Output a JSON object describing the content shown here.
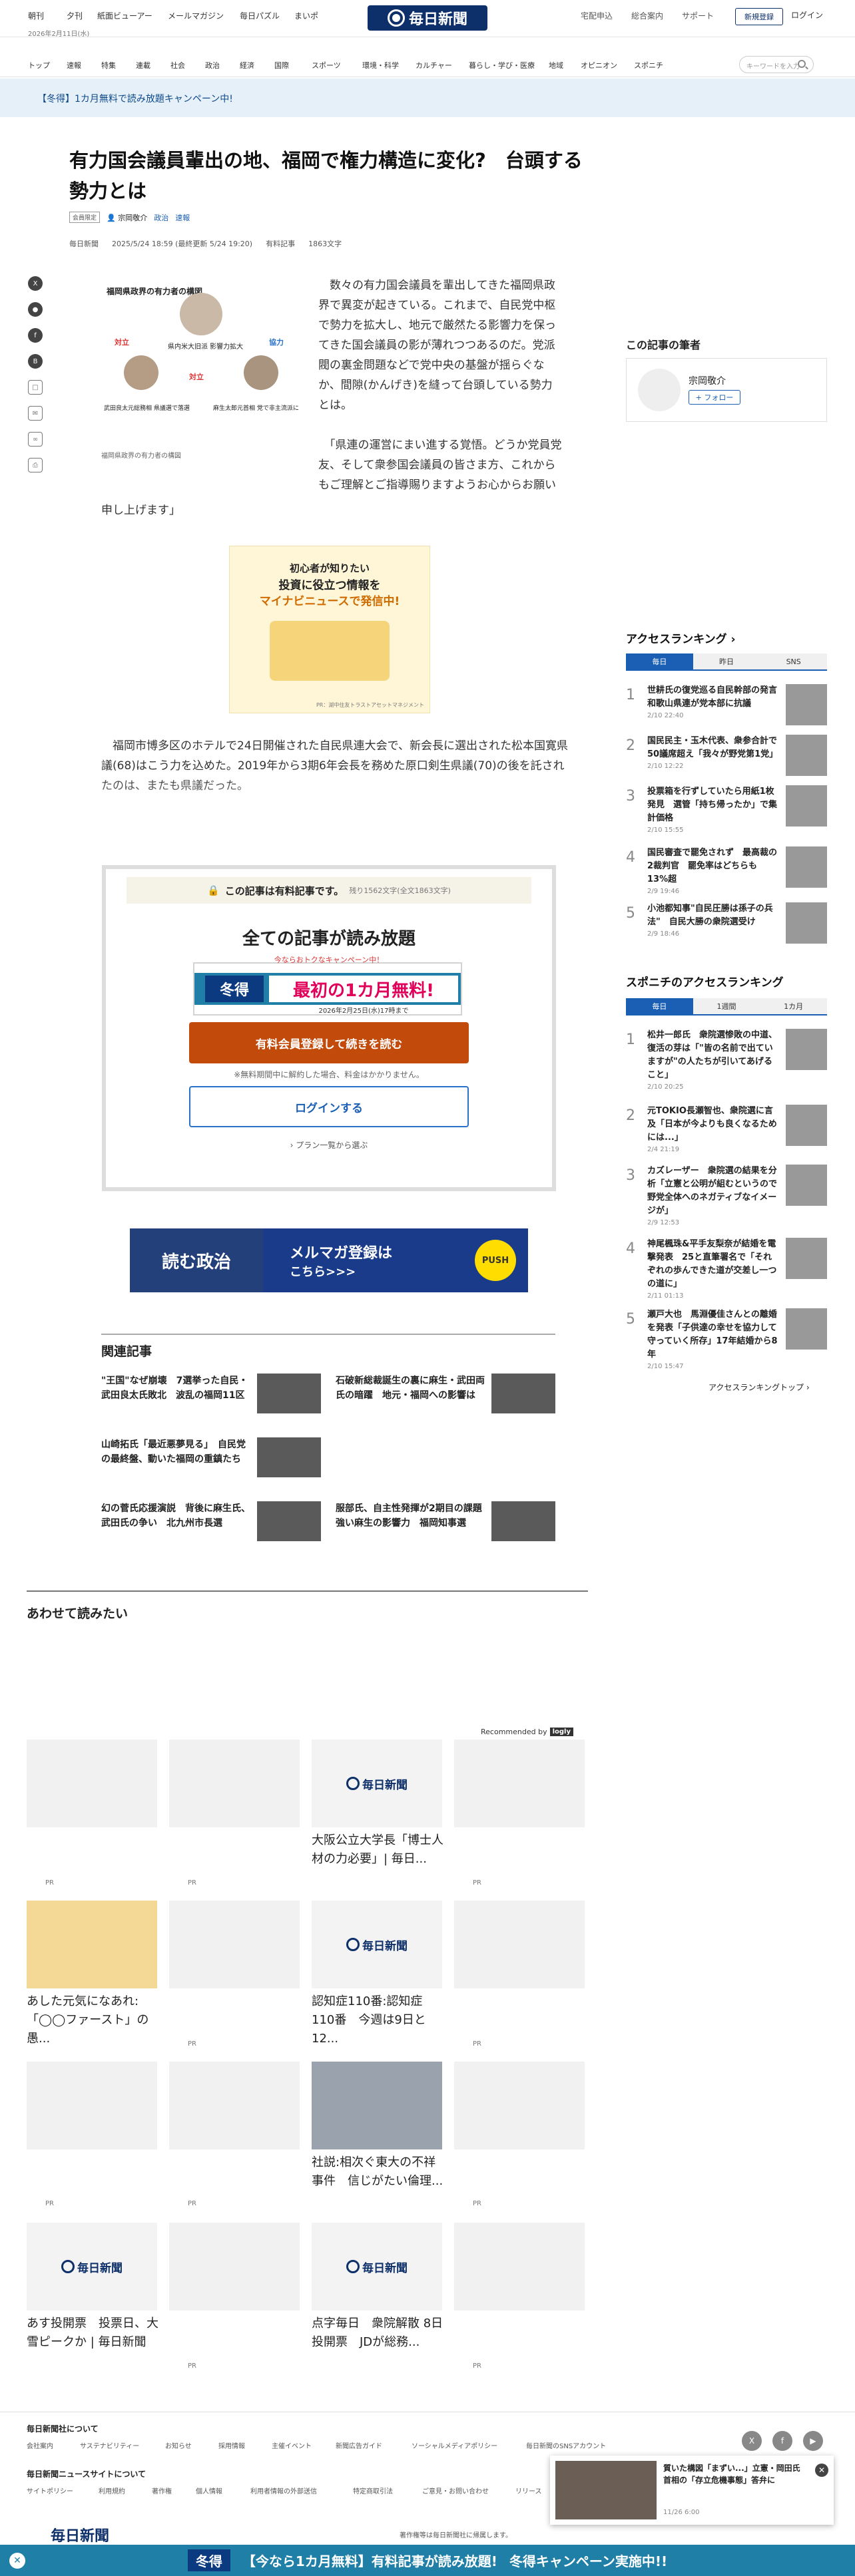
{
  "header": {
    "top_links": [
      "朝刊",
      "夕刊",
      "紙面ビューアー",
      "メールマガジン",
      "毎日パズル",
      "まいポ"
    ],
    "date": "2026年2月11日(水)",
    "logo": "毎日新聞",
    "right_links": [
      "宅配申込",
      "総合案内",
      "サポート"
    ],
    "register": "新規登録",
    "login": "ログイン"
  },
  "nav": {
    "items": [
      "トップ",
      "速報",
      "特集",
      "連載",
      "社会",
      "政治",
      "経済",
      "国際",
      "スポーツ",
      "環境・科学",
      "カルチャー",
      "暮らし・学び・医療",
      "地域",
      "オピニオン",
      "スポニチ"
    ],
    "search_placeholder": "キーワードを入力"
  },
  "campaign": {
    "text": "【冬得】1カ月無料で読み放題キャンペーン中!"
  },
  "article": {
    "title": "有力国会議員輩出の地、福岡で権力構造に変化?　台頭する勢力とは",
    "tag_badge": "会員限定",
    "author": "宗岡敬介",
    "cats": [
      "政治",
      "速報"
    ],
    "meta": [
      "毎日新聞",
      "2025/5/24 18:59 (最終更新 5/24 19:20)",
      "有料記事",
      "1863文字"
    ],
    "photo_caption": "福岡県政界の有力者の構図",
    "photo_labels": {
      "title": "福岡県政界の有力者の構図",
      "opp": "対立",
      "coop": "協力",
      "center": "県内米大旧派 影響力拡大",
      "opp2": "対立",
      "left": "武田良太元総務相 県議選で落選",
      "right": "麻生太郎元首相 党で非主流派に"
    },
    "p1": "　数々の有力国会議員を輩出してきた福岡県政界で異変が起きている。これまで、自民党中枢で勢力を拡大し、地元で厳然たる影響力を保ってきた国会議員の影が薄れつつあるのだ。党派閥の裏金問題などで党中央の基盤が揺らぐなか、間隙(かんげき)を縫って台頭している勢力とは。",
    "p2": "　「県連の運営にまい進する覚悟。どうか党員党友、そして衆参国会議員の皆さま方、これからもご理解とご指導賜りますようお心からお願い",
    "p3": "申し上げます」",
    "ad1": {
      "line1": "初心者が知りたい",
      "line2": "投資に役立つ情報を",
      "line3": "マイナビニュースで発信中!",
      "small": "PR：湖中住友トラストアセットマネジメント"
    },
    "p4": "　福岡市博多区のホテルで24日開催された自民県連大会で、新会長に選出された松本国寛県議(68)はこう力を込めた。2019年から3期6年会長を務めた原口剣生県議(70)の後を託されたのは、またも県議だった。"
  },
  "paywall": {
    "title": "この記事は有料記事です。",
    "remaining": "残り1562文字(全文1863文字)",
    "headline": "全ての記事が読み放題",
    "sub": "今ならおトクなキャンペーン中！",
    "banner_badge": "冬得",
    "banner_main": "最初の1カ月無料!",
    "banner_until": "2026年2月25日(水)17時まで",
    "cta": "有料会員登録して続きを読む",
    "note": "※無料期間中に解約した場合、料金はかかりません。",
    "login": "ログインする",
    "plans": "プラン一覧から選ぶ"
  },
  "ad2": {
    "left": "読む政治",
    "text": "メルマガ登録は",
    "text2": "こちら>>>",
    "push": "PUSH"
  },
  "related": {
    "title": "関連記事",
    "items": [
      "\"王国\"なぜ崩壊　7選挙った自民・武田良太氏敗北　波乱の福岡11区",
      "石破新総裁誕生の裏に麻生・武田両氏の暗躍　地元・福岡への影響は",
      "山崎拓氏「最近悪夢見る」　自民党の最終盤、動いた福岡の重鎮たち",
      "幻の菅氏応援演説　背後に麻生氏、武田氏の争い　北九州市長選",
      "服部氏、自主性発揮が2期目の課題　強い麻生の影響力　福岡知事選"
    ]
  },
  "also": {
    "title": "あわせて読みたい",
    "recommended": "Recommended by",
    "rec_logo": "logly",
    "pr": "PR",
    "cards": [
      "大阪公立大学長「博士人材の力必要」| 毎日...",
      "あした元気になあれ:「◯◯ファースト」の愚...",
      "認知症110番:認知症110番　今週は9日と12...",
      "社説:相次ぐ東大の不祥事件　信じがたい倫理...",
      "あす投開票　投票日、大雪ピークか | 毎日新聞",
      "点字毎日　衆院解散 8日投開票　JDが総務..."
    ],
    "logo": "毎日新聞"
  },
  "sidebar": {
    "author_head": "この記事の筆者",
    "author": "宗岡敬介",
    "follow": "+ フォロー",
    "ranking_head": "アクセスランキング",
    "tabs": [
      "毎日",
      "昨日",
      "SNS"
    ],
    "ranking": [
      {
        "t": "世耕氏の復党巡る自民幹部の発言　和歌山県連が党本部に抗議",
        "d": "2/10 22:40"
      },
      {
        "t": "国民民主・玉木代表、衆参合計で50議席超え「我々が野党第1党」",
        "d": "2/10 12:22"
      },
      {
        "t": "投票箱を行ずしていたら用紙1枚発見　選管「持ち帰ったか」で集計価格",
        "d": "2/10 15:55"
      },
      {
        "t": "国民審査で罷免されず　最高裁の2裁判官　罷免率はどちらも13%超",
        "d": "2/9 19:46"
      },
      {
        "t": "小池都知事\"自民圧勝は孫子の兵法\"　自民大勝の衆院選受け",
        "d": "2/9 18:46"
      }
    ],
    "spn_head": "スポニチのアクセスランキング",
    "spn_tabs": [
      "毎日",
      "1週間",
      "1カ月"
    ],
    "spn": [
      {
        "t": "松井一郎氏　衆院選惨敗の中道、復活の芽は「\"皆の名前で出ていますが\"の人たちが引いてあげること」",
        "d": "2/10 20:25"
      },
      {
        "t": "元TOKIO長瀬智也、衆院選に言及「日本が今よりも良くなるためには...」",
        "d": "2/4 21:19"
      },
      {
        "t": "カズレーザー　衆院選の結果を分析「立憲と公明が組むというので野党全体へのネガティブなイメージが」",
        "d": "2/9 12:53"
      },
      {
        "t": "神尾楓珠&平手友梨奈が結婚を電撃発表　25と直筆署名で「それぞれの歩んできた道が交差し一つの道に」",
        "d": "2/11 01:13"
      },
      {
        "t": "瀬戸大也　馬淵優佳さんとの離婚を発表「子供達の幸せを協力して守っていく所存」17年結婚から8年",
        "d": "2/10 15:47"
      }
    ],
    "more": "アクセスランキングトップ"
  },
  "footer": {
    "h1": "毎日新聞社について",
    "links1": [
      "会社案内",
      "サステナビリティー",
      "お知らせ",
      "採用情報",
      "主催イベント",
      "新聞広告ガイド",
      "ソーシャルメディアポリシー",
      "毎日新聞のSNSアカウント"
    ],
    "h2": "毎日新聞ニュースサイトについて",
    "links2": [
      "サイトポリシー",
      "利用規約",
      "著作権",
      "個人情報",
      "利用者情報の外部送信",
      "特定商取引法",
      "ご意見・お問い合わせ",
      "リリース"
    ],
    "copyright": "著作権等は毎日新聞社に帰属します。",
    "popup_title": "質いた構図「まずい...」立憲・岡田氏 首相の「存立危機事態」答弁に",
    "popup_date": "11/26 6:00"
  },
  "bottom": {
    "badge": "冬得",
    "text": "【今なら1カ月無料】有料記事が読み放題!",
    "text2": "冬得キャンペーン実施中!!"
  }
}
